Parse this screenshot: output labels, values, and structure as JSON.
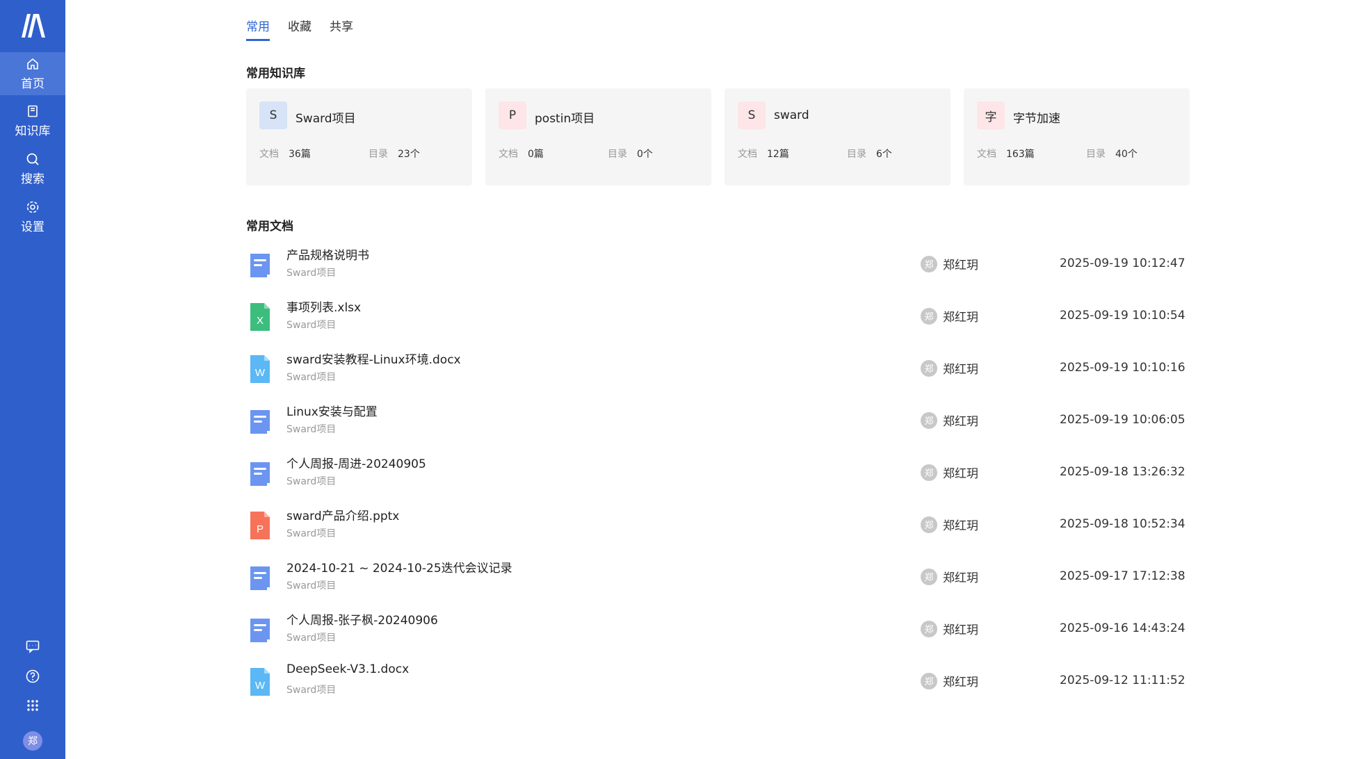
{
  "sidebar": {
    "nav": [
      {
        "label": "首页",
        "icon": "home-icon"
      },
      {
        "label": "知识库",
        "icon": "book-icon"
      },
      {
        "label": "搜索",
        "icon": "search-icon"
      },
      {
        "label": "设置",
        "icon": "gear-icon"
      }
    ],
    "bottom_icons": [
      "message-icon",
      "help-icon",
      "apps-grid-icon"
    ],
    "avatar": "郑",
    "colors": {
      "background": "#2f5fcb",
      "active": "#4a76d8"
    }
  },
  "tabs": [
    "常用",
    "收藏",
    "共享"
  ],
  "sections": {
    "repos_title": "常用知识库",
    "docs_title": "常用文档"
  },
  "repos": [
    {
      "initial": "S",
      "name": "Sward项目",
      "doc_label": "文档",
      "doc_count": "36篇",
      "dir_label": "目录",
      "dir_count": "23个",
      "icon_color": "#d7e3f7"
    },
    {
      "initial": "P",
      "name": "postin项目",
      "doc_label": "文档",
      "doc_count": "0篇",
      "dir_label": "目录",
      "dir_count": "0个",
      "icon_color": "#fde5e8"
    },
    {
      "initial": "S",
      "name": "sward",
      "doc_label": "文档",
      "doc_count": "12篇",
      "dir_label": "目录",
      "dir_count": "6个",
      "icon_color": "#fde5e8"
    },
    {
      "initial": "字",
      "name": "字节加速",
      "doc_label": "文档",
      "doc_count": "163篇",
      "dir_label": "目录",
      "dir_count": "40个",
      "icon_color": "#fde5e8"
    }
  ],
  "docs": [
    {
      "type": "doc",
      "name": "产品规格说明书",
      "repo": "Sward项目",
      "user_initial": "郑",
      "user": "郑红玥",
      "time": "2025-09-19 10:12:47"
    },
    {
      "type": "xlsx",
      "name": "事项列表.xlsx",
      "repo": "Sward项目",
      "user_initial": "郑",
      "user": "郑红玥",
      "time": "2025-09-19 10:10:54"
    },
    {
      "type": "docx",
      "name": "sward安装教程-Linux环境.docx",
      "repo": "Sward项目",
      "user_initial": "郑",
      "user": "郑红玥",
      "time": "2025-09-19 10:10:16"
    },
    {
      "type": "doc",
      "name": "Linux安装与配置",
      "repo": "Sward项目",
      "user_initial": "郑",
      "user": "郑红玥",
      "time": "2025-09-19 10:06:05"
    },
    {
      "type": "doc",
      "name": "个人周报-周进-20240905",
      "repo": "Sward项目",
      "user_initial": "郑",
      "user": "郑红玥",
      "time": "2025-09-18 13:26:32"
    },
    {
      "type": "pptx",
      "name": "sward产品介绍.pptx",
      "repo": "Sward项目",
      "user_initial": "郑",
      "user": "郑红玥",
      "time": "2025-09-18 10:52:34"
    },
    {
      "type": "doc",
      "name": "2024-10-21 ~ 2024-10-25迭代会议记录",
      "repo": "Sward项目",
      "user_initial": "郑",
      "user": "郑红玥",
      "time": "2025-09-17 17:12:38"
    },
    {
      "type": "doc",
      "name": "个人周报-张子枫-20240906",
      "repo": "Sward项目",
      "user_initial": "郑",
      "user": "郑红玥",
      "time": "2025-09-16 14:43:24"
    },
    {
      "type": "docx",
      "name": "DeepSeek-V3.1.docx",
      "repo": "Sward项目",
      "user_initial": "郑",
      "user": "郑红玥",
      "time": "2025-09-12 11:11:52"
    }
  ],
  "colors": {
    "accent": "#2f66d0",
    "doc": "#6b95f0",
    "xlsx": "#3dbd7d",
    "docx": "#5bb8f5",
    "pptx": "#f6735a"
  }
}
